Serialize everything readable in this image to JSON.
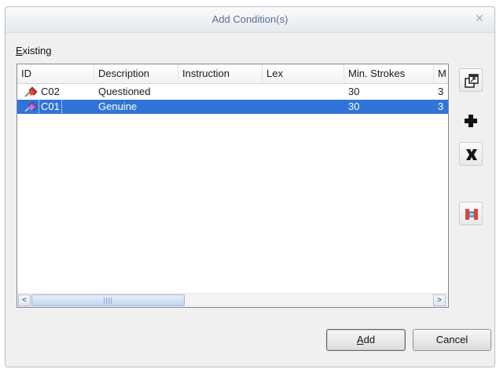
{
  "dialog": {
    "title": "Add Condition(s)",
    "close_glyph": "✕"
  },
  "group": {
    "label_mnemonic": "E",
    "label_rest": "xisting"
  },
  "table": {
    "columns": [
      "ID",
      "Description",
      "Instruction",
      "Lex",
      "Min. Strokes",
      "M"
    ],
    "rows": [
      {
        "id": "C02",
        "description": "Questioned",
        "instruction": "",
        "lex": "",
        "min_strokes": "30",
        "m": "3",
        "selected": false
      },
      {
        "id": "C01",
        "description": "Genuine",
        "instruction": "",
        "lex": "",
        "min_strokes": "30",
        "m": "3",
        "selected": true
      }
    ],
    "row_icon": "pushpin-icon",
    "selection_color": "#3074d9"
  },
  "scrollbar": {
    "left_arrow": "<",
    "right_arrow": ">"
  },
  "side_buttons": [
    {
      "icon": "properties-icon",
      "tooltip": ""
    },
    {
      "icon": "add-icon",
      "tooltip": ""
    },
    {
      "icon": "delete-icon",
      "tooltip": ""
    },
    {
      "icon": "compare-icon",
      "tooltip": ""
    }
  ],
  "buttons": {
    "add_mnemonic": "A",
    "add_rest": "dd",
    "cancel": "Cancel"
  }
}
